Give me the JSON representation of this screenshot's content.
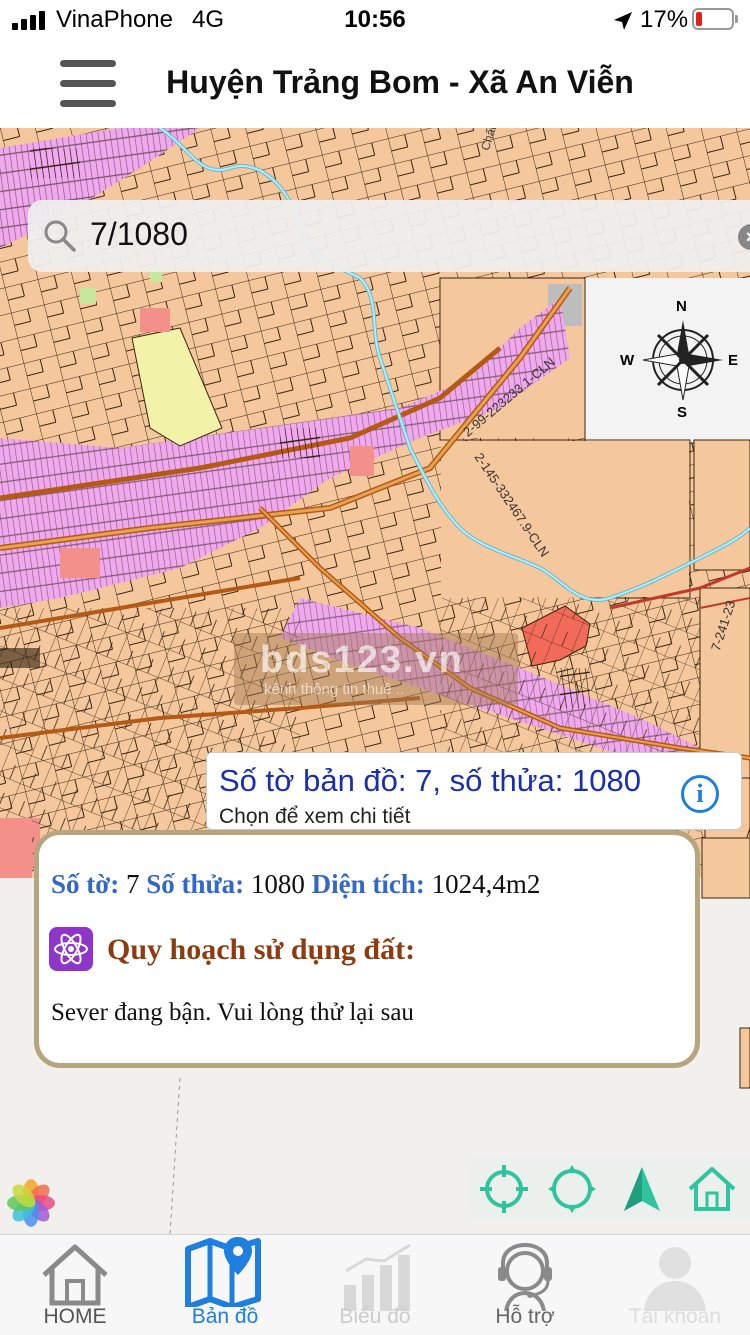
{
  "status_bar": {
    "carrier": "VinaPhone",
    "network": "4G",
    "time": "10:56",
    "battery_percent": "17%",
    "battery_level": 0.17
  },
  "header": {
    "title": "Huyện Trảng Bom - Xã An Viễn"
  },
  "map": {
    "watermark": "bds123.vn",
    "watermark_sub": "kênh thông tin thuê ..",
    "labels": {
      "parcel_a": "2-99-223233.1-CLN",
      "parcel_b": "2-145-332467.9-CLN",
      "parcel_c": "7-241-23",
      "road": "Chất tha"
    },
    "compass": {
      "n": "N",
      "s": "S",
      "e": "E",
      "w": "W"
    }
  },
  "search": {
    "value": "7/1080"
  },
  "popup": {
    "title": "Số tờ bản đồ: 7, số thửa: 1080",
    "subtitle": "Chọn để xem chi tiết",
    "info_icon": "info-icon"
  },
  "detail": {
    "sheet_label": "Số tờ:",
    "sheet_value": "7",
    "parcel_label": "Số thửa:",
    "parcel_value": "1080",
    "area_label": "Diện tích:",
    "area_value": "1024,4m2",
    "plan_title": "Quy hoạch sử dụng đất:",
    "message": "Sever đang bận. Vui lòng thử lại sau"
  },
  "tools": [
    "locate-icon",
    "gps-icon",
    "navigation-arrow-icon",
    "home-icon"
  ],
  "tabs": [
    {
      "label": "HOME",
      "icon": "home-icon",
      "active": false
    },
    {
      "label": "Bản đồ",
      "icon": "map-icon",
      "active": true
    },
    {
      "label": "Biểu đồ",
      "icon": "chart-icon",
      "active": false
    },
    {
      "label": "Hỗ trợ",
      "icon": "support-icon",
      "active": false
    },
    {
      "label": "Tài khoản",
      "icon": "account-icon",
      "active": false
    }
  ],
  "colors": {
    "active_tab": "#1e7fe0",
    "inactive_tab": "#999999",
    "label_blue": "#3468c7",
    "plan_brown": "#8e3c0e",
    "map_base": "#f5c79c",
    "map_pink": "#f0a8ee",
    "river": "#8fd3e0",
    "tool_green": "#2ec4a0"
  }
}
